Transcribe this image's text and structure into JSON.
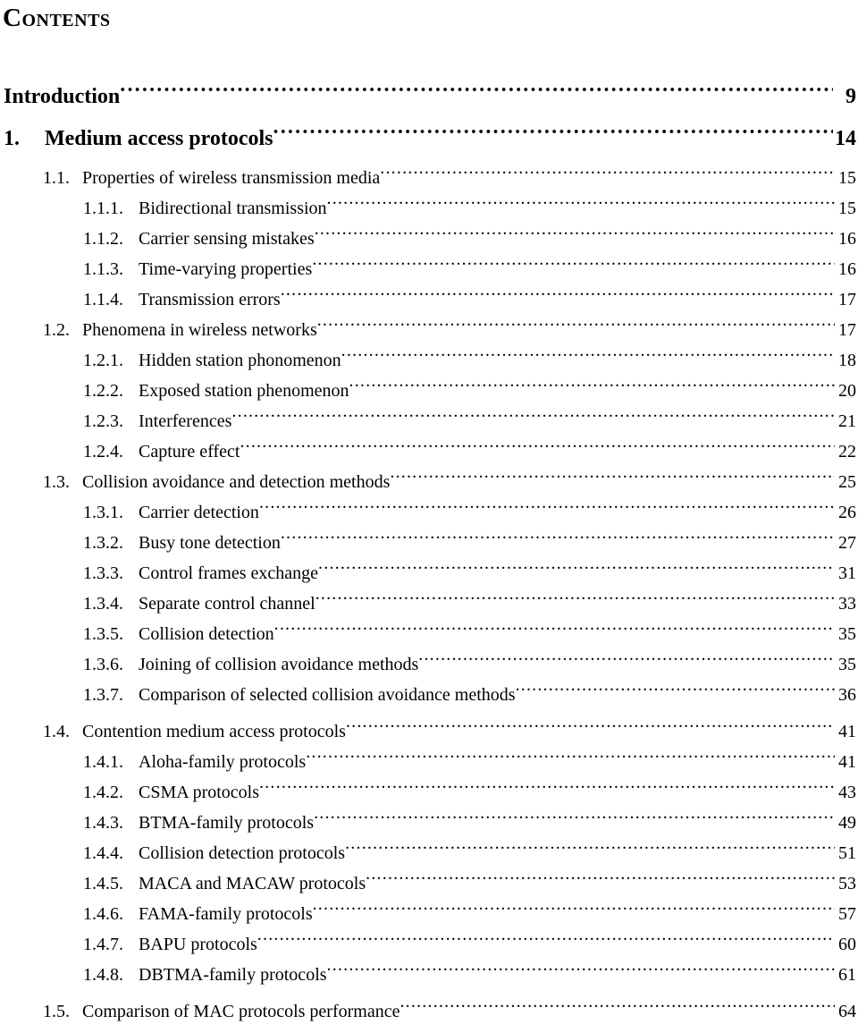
{
  "heading": "Contents",
  "leader_dot": ".",
  "toc": {
    "entries": [
      {
        "level": 1,
        "number": "",
        "title": "Introduction",
        "page": "9",
        "gap": "none"
      },
      {
        "level": 1,
        "number": "1.",
        "title": "Medium access protocols",
        "page": "14",
        "gap": "small"
      },
      {
        "level": 2,
        "number": "1.1.",
        "title": "Properties of wireless transmission media",
        "page": "15",
        "gap": "small"
      },
      {
        "level": 3,
        "number": "1.1.1.",
        "title": "Bidirectional transmission",
        "page": "15",
        "gap": "none"
      },
      {
        "level": 3,
        "number": "1.1.2.",
        "title": "Carrier sensing mistakes",
        "page": "16",
        "gap": "none"
      },
      {
        "level": 3,
        "number": "1.1.3.",
        "title": "Time-varying properties",
        "page": "16",
        "gap": "none"
      },
      {
        "level": 3,
        "number": "1.1.4.",
        "title": "Transmission errors",
        "page": "17",
        "gap": "none"
      },
      {
        "level": 2,
        "number": "1.2.",
        "title": "Phenomena in wireless networks",
        "page": "17",
        "gap": "none"
      },
      {
        "level": 3,
        "number": "1.2.1.",
        "title": "Hidden station phonomenon",
        "page": "18",
        "gap": "none"
      },
      {
        "level": 3,
        "number": "1.2.2.",
        "title": "Exposed station phenomenon",
        "page": "20",
        "gap": "none"
      },
      {
        "level": 3,
        "number": "1.2.3.",
        "title": "Interferences",
        "page": "21",
        "gap": "none"
      },
      {
        "level": 3,
        "number": "1.2.4.",
        "title": "Capture effect",
        "page": "22",
        "gap": "none"
      },
      {
        "level": 2,
        "number": "1.3.",
        "title": "Collision avoidance and detection methods",
        "page": "25",
        "gap": "none"
      },
      {
        "level": 3,
        "number": "1.3.1.",
        "title": "Carrier detection",
        "page": "26",
        "gap": "none"
      },
      {
        "level": 3,
        "number": "1.3.2.",
        "title": "Busy tone detection",
        "page": "27",
        "gap": "none"
      },
      {
        "level": 3,
        "number": "1.3.3.",
        "title": "Control frames exchange",
        "page": "31",
        "gap": "none"
      },
      {
        "level": 3,
        "number": "1.3.4.",
        "title": "Separate control channel",
        "page": "33",
        "gap": "none"
      },
      {
        "level": 3,
        "number": "1.3.5.",
        "title": "Collision detection",
        "page": "35",
        "gap": "none"
      },
      {
        "level": 3,
        "number": "1.3.6.",
        "title": "Joining of collision avoidance methods",
        "page": "35",
        "gap": "none"
      },
      {
        "level": 3,
        "number": "1.3.7.",
        "title": "Comparison of selected collision avoidance methods",
        "page": "36",
        "gap": "none"
      },
      {
        "level": 2,
        "number": "1.4.",
        "title": "Contention medium access protocols",
        "page": "41",
        "gap": "small"
      },
      {
        "level": 3,
        "number": "1.4.1.",
        "title": "Aloha-family protocols",
        "page": "41",
        "gap": "none"
      },
      {
        "level": 3,
        "number": "1.4.2.",
        "title": "CSMA protocols",
        "page": "43",
        "gap": "none"
      },
      {
        "level": 3,
        "number": "1.4.3.",
        "title": "BTMA-family protocols",
        "page": "49",
        "gap": "none"
      },
      {
        "level": 3,
        "number": "1.4.4.",
        "title": "Collision detection protocols",
        "page": "51",
        "gap": "none"
      },
      {
        "level": 3,
        "number": "1.4.5.",
        "title": "MACA and MACAW protocols",
        "page": "53",
        "gap": "none"
      },
      {
        "level": 3,
        "number": "1.4.6.",
        "title": "FAMA-family protocols",
        "page": "57",
        "gap": "none"
      },
      {
        "level": 3,
        "number": "1.4.7.",
        "title": "BAPU protocols",
        "page": "60",
        "gap": "none"
      },
      {
        "level": 3,
        "number": "1.4.8.",
        "title": "DBTMA-family protocols",
        "page": "61",
        "gap": "none"
      },
      {
        "level": 2,
        "number": "1.5.",
        "title": "Comparison of MAC protocols performance",
        "page": "64",
        "gap": "small"
      }
    ]
  }
}
